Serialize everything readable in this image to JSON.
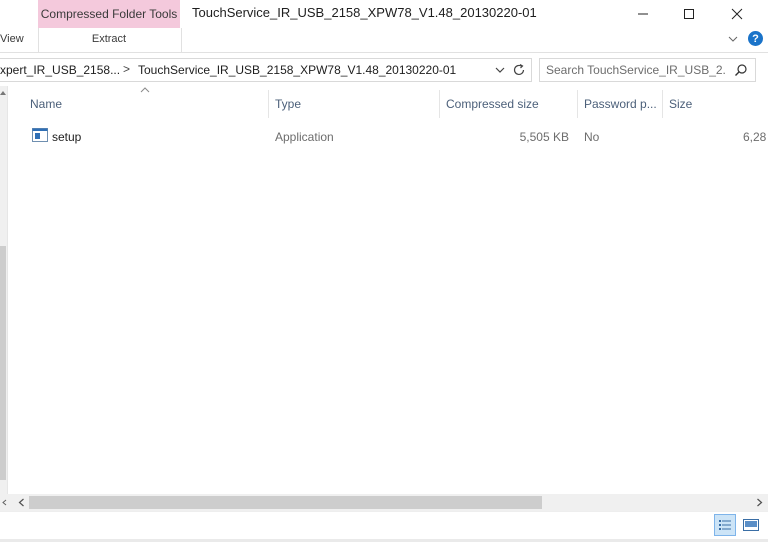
{
  "window": {
    "title": "TouchService_IR_USB_2158_XPW78_V1.48_20130220-01",
    "context_tab_group": "Compressed Folder Tools",
    "context_tab_color": "#f4c9dc"
  },
  "ribbon": {
    "tabs": [
      {
        "label": "View"
      },
      {
        "label": "Extract"
      }
    ],
    "help_label": "?"
  },
  "address": {
    "parent": "xpert_IR_USB_2158...",
    "separator": ">",
    "current": "TouchService_IR_USB_2158_XPW78_V1.48_20130220-01"
  },
  "search": {
    "placeholder": "Search TouchService_IR_USB_2..."
  },
  "table": {
    "columns": [
      "Name",
      "Type",
      "Compressed size",
      "Password p...",
      "Size"
    ],
    "rows": [
      {
        "name": "setup",
        "type": "Application",
        "compressed_size": "5,505 KB",
        "password_protected": "No",
        "size": "6,28"
      }
    ]
  },
  "icons": {
    "minimize": "minimize-icon",
    "maximize": "maximize-icon",
    "close": "close-icon",
    "search": "search-icon",
    "refresh": "refresh-icon",
    "dropdown": "chevron-down-icon",
    "file": "application-icon",
    "details_view": "details-view-icon",
    "tiles_view": "large-icons-view-icon"
  },
  "colors": {
    "accent": "#1a73c9",
    "column_header_text": "#4c607a",
    "selected_view_bg": "#cce4f7"
  }
}
